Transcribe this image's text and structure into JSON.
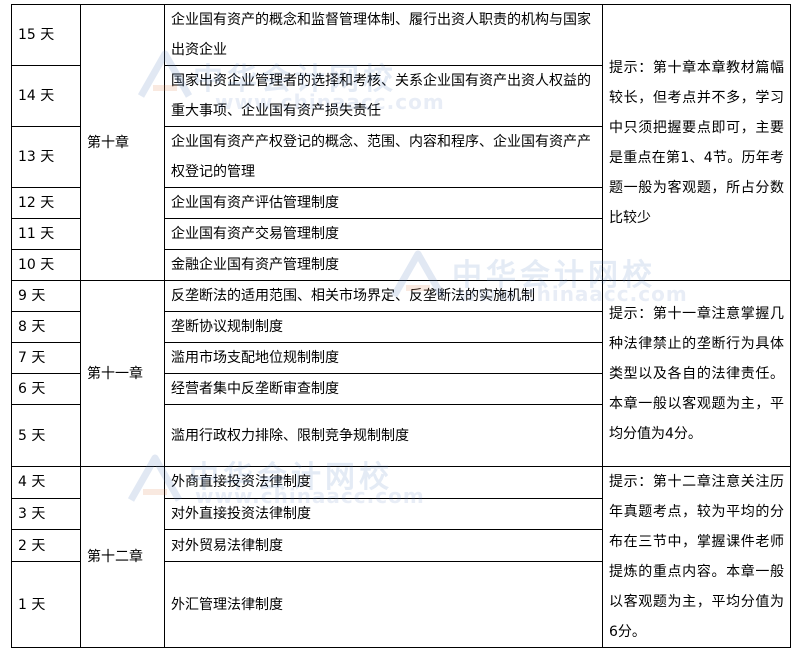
{
  "watermark": {
    "text": "中华会计网校",
    "url": "www.chinaacc.com"
  },
  "chapters": [
    {
      "name": "第十章",
      "tip": "提示：第十章本章教材篇幅较长，但考点并不多，学习中只须把握要点即可，主要是重点在第1、4节。历年考题一般为客观题，所占分数比较少",
      "rows": [
        {
          "day": "15 天",
          "topic": "企业国有资产的概念和监督管理体制、履行出资人职责的机构与国家出资企业"
        },
        {
          "day": "14 天",
          "topic": "国家出资企业管理者的选择和考核、关系企业国有资产出资人权益的重大事项、企业国有资产损失责任"
        },
        {
          "day": "13 天",
          "topic": "企业国有资产产权登记的概念、范围、内容和程序、企业国有资产产权登记的管理"
        },
        {
          "day": "12 天",
          "topic": "企业国有资产评估管理制度"
        },
        {
          "day": "11 天",
          "topic": "企业国有资产交易管理制度"
        },
        {
          "day": "10 天",
          "topic": "金融企业国有资产管理制度"
        }
      ]
    },
    {
      "name": "第十一章",
      "tip": "提示：第十一章注意掌握几种法律禁止的垄断行为具体类型以及各自的法律责任。本章一般以客观题为主，平均分值为4分。",
      "rows": [
        {
          "day": "9 天",
          "topic": "反垄断法的适用范围、相关市场界定、反垄断法的实施机制"
        },
        {
          "day": "8 天",
          "topic": "垄断协议规制制度"
        },
        {
          "day": "7 天",
          "topic": "滥用市场支配地位规制制度"
        },
        {
          "day": "6 天",
          "topic": "经营者集中反垄断审查制度"
        },
        {
          "day": "5 天",
          "topic": "滥用行政权力排除、限制竞争规制制度"
        }
      ]
    },
    {
      "name": "第十二章",
      "tip": "提示：第十二章注意关注历年真题考点，较为平均的分布在三节中，掌握课件老师提炼的重点内容。本章一般以客观题为主，平均分值为6分。",
      "rows": [
        {
          "day": "4 天",
          "topic": "外商直接投资法律制度"
        },
        {
          "day": "3 天",
          "topic": "对外直接投资法律制度"
        },
        {
          "day": "2 天",
          "topic": "对外贸易法律制度"
        },
        {
          "day": "1 天",
          "topic": "外汇管理法律制度"
        }
      ]
    }
  ]
}
